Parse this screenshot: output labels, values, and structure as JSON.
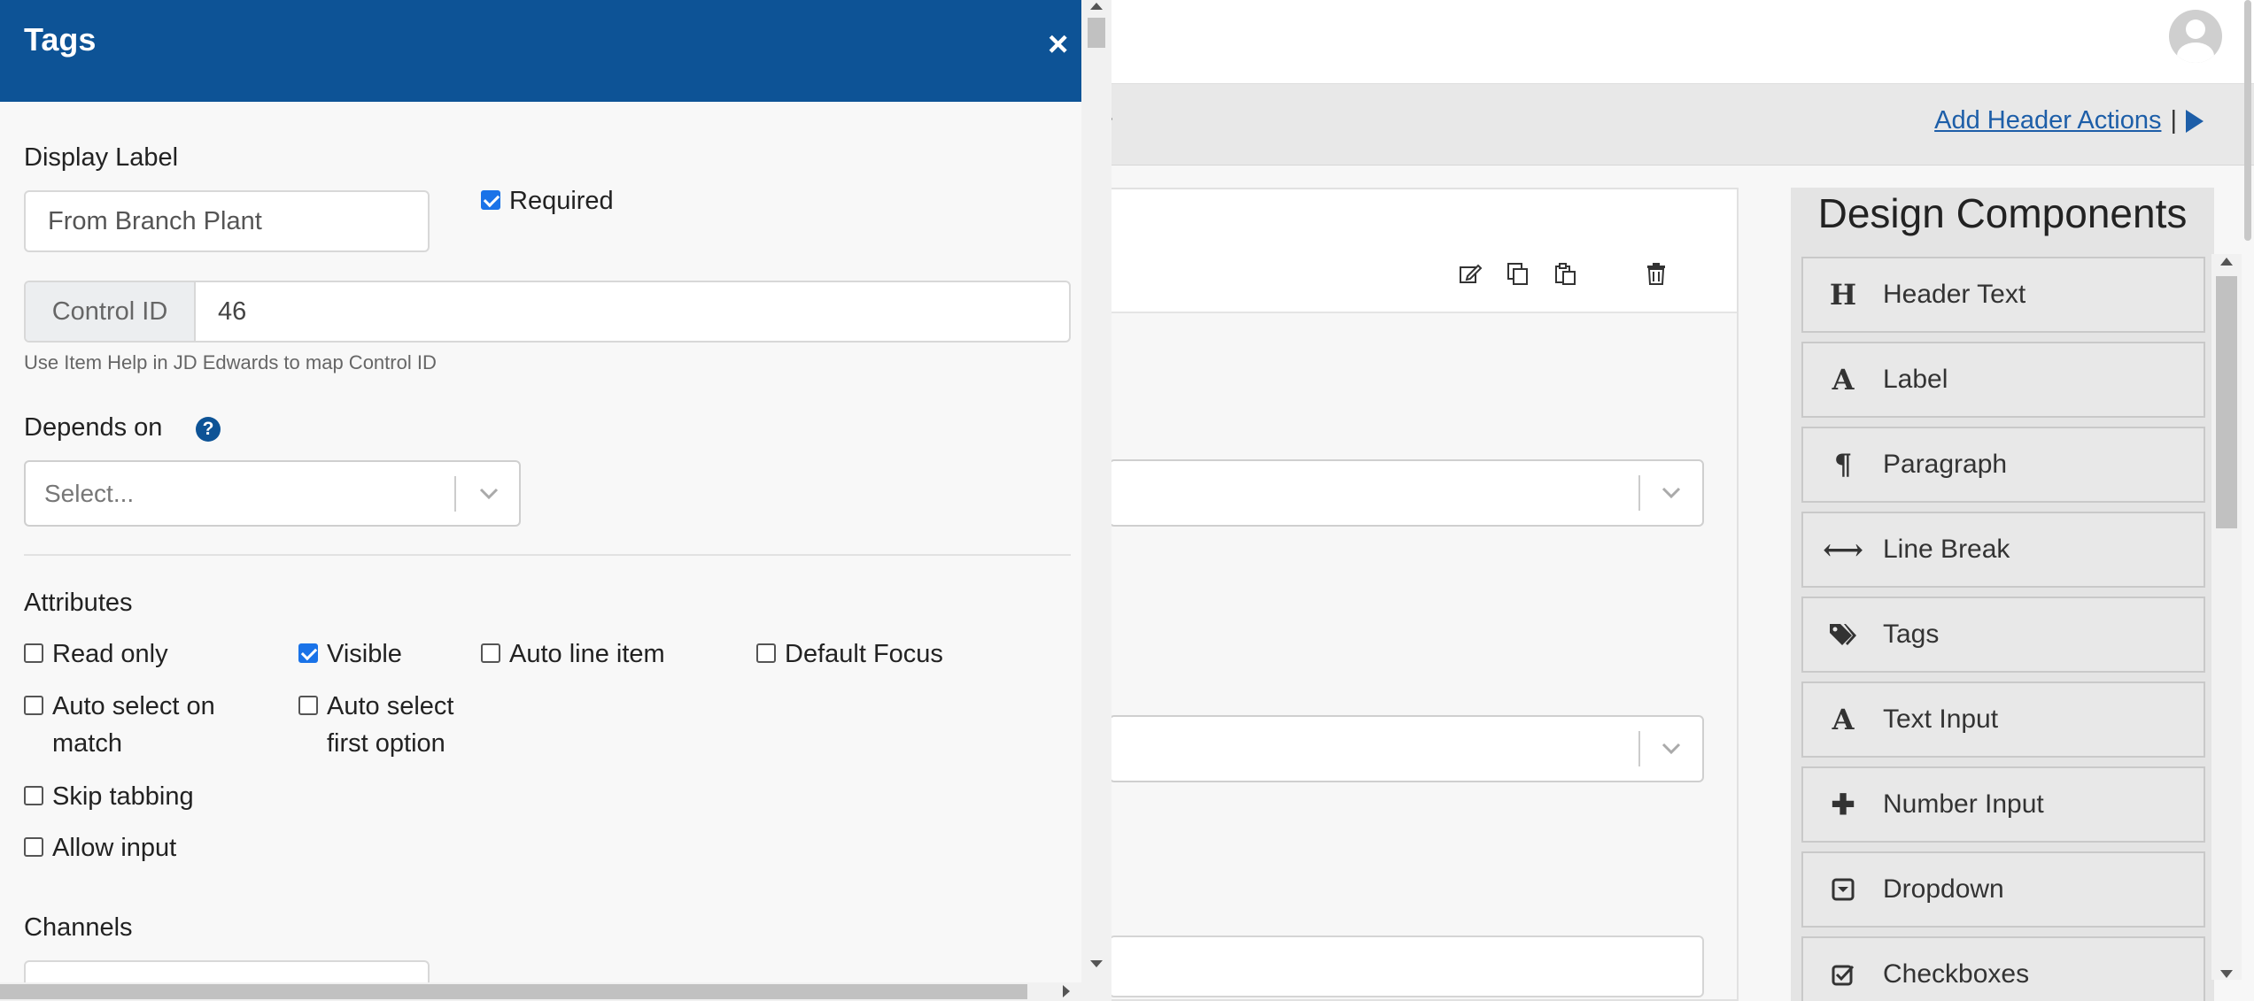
{
  "app": {
    "toolbar_stub": "r",
    "header_actions_label": "Add Header Actions",
    "header_actions_separator": "|"
  },
  "drawer": {
    "title": "Tags",
    "close_glyph": "×",
    "display_label": {
      "label": "Display Label",
      "value": "From Branch Plant"
    },
    "required": {
      "label": "Required",
      "checked": true
    },
    "control_id": {
      "addon": "Control ID",
      "value": "46",
      "help": "Use Item Help in JD Edwards to map Control ID"
    },
    "depends_on": {
      "label": "Depends on",
      "help_glyph": "?",
      "placeholder": "Select..."
    },
    "attributes": {
      "heading": "Attributes",
      "items": [
        {
          "label": "Read only",
          "checked": false
        },
        {
          "label": "Visible",
          "checked": true
        },
        {
          "label": "Auto line item",
          "checked": false
        },
        {
          "label": "Default Focus",
          "checked": false
        },
        {
          "label": "Auto select on match",
          "checked": false
        },
        {
          "label": "Auto select first option",
          "checked": false
        },
        {
          "label": "Skip tabbing",
          "checked": false
        },
        {
          "label": "Allow input",
          "checked": false
        }
      ]
    },
    "channels": {
      "heading": "Channels"
    }
  },
  "design_components": {
    "title": "Design Components",
    "items": [
      {
        "label": "Header Text",
        "icon": "header-icon",
        "glyph": "H"
      },
      {
        "label": "Label",
        "icon": "label-icon",
        "glyph": "A"
      },
      {
        "label": "Paragraph",
        "icon": "paragraph-icon",
        "glyph": "¶"
      },
      {
        "label": "Line Break",
        "icon": "line-break-icon",
        "glyph": "⟷"
      },
      {
        "label": "Tags",
        "icon": "tags-icon",
        "glyph": ""
      },
      {
        "label": "Text Input",
        "icon": "text-input-icon",
        "glyph": "A"
      },
      {
        "label": "Number Input",
        "icon": "plus-icon",
        "glyph": "✚"
      },
      {
        "label": "Dropdown",
        "icon": "dropdown-icon",
        "glyph": ""
      },
      {
        "label": "Checkboxes",
        "icon": "checkbox-icon",
        "glyph": ""
      }
    ]
  },
  "colors": {
    "drawer_header": "#0d5396",
    "link": "#1d5ea8",
    "checkbox_checked": "#1a73e8"
  }
}
